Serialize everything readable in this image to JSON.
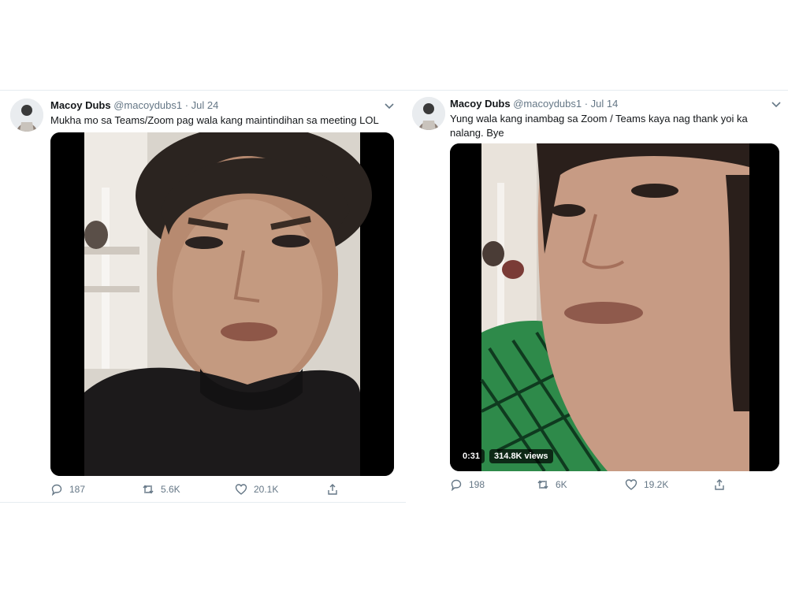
{
  "tweets": [
    {
      "author_name": "Macoy Dubs",
      "author_handle": "@macoydubs1",
      "date": "· Jul 24",
      "text": "Mukha mo sa Teams/Zoom pag wala kang maintindihan sa meeting LOL",
      "media_description": "",
      "actions": {
        "replies": "187",
        "retweets": "5.6K",
        "likes": "20.1K"
      }
    },
    {
      "author_name": "Macoy Dubs",
      "author_handle": "@macoydubs1",
      "date": "· Jul 14",
      "text": "Yung wala kang inambag sa Zoom / Teams kaya nag thank yoi ka nalang. Bye",
      "video": {
        "duration": "0:31",
        "views": "314.8K views"
      },
      "actions": {
        "replies": "198",
        "retweets": "6K",
        "likes": "19.2K"
      }
    }
  ],
  "colors": {
    "text": "#14171a",
    "muted": "#657786",
    "border": "#e6ecf0"
  },
  "icons": [
    "reply-icon",
    "retweet-icon",
    "like-icon",
    "share-icon",
    "chevron-down-icon"
  ]
}
